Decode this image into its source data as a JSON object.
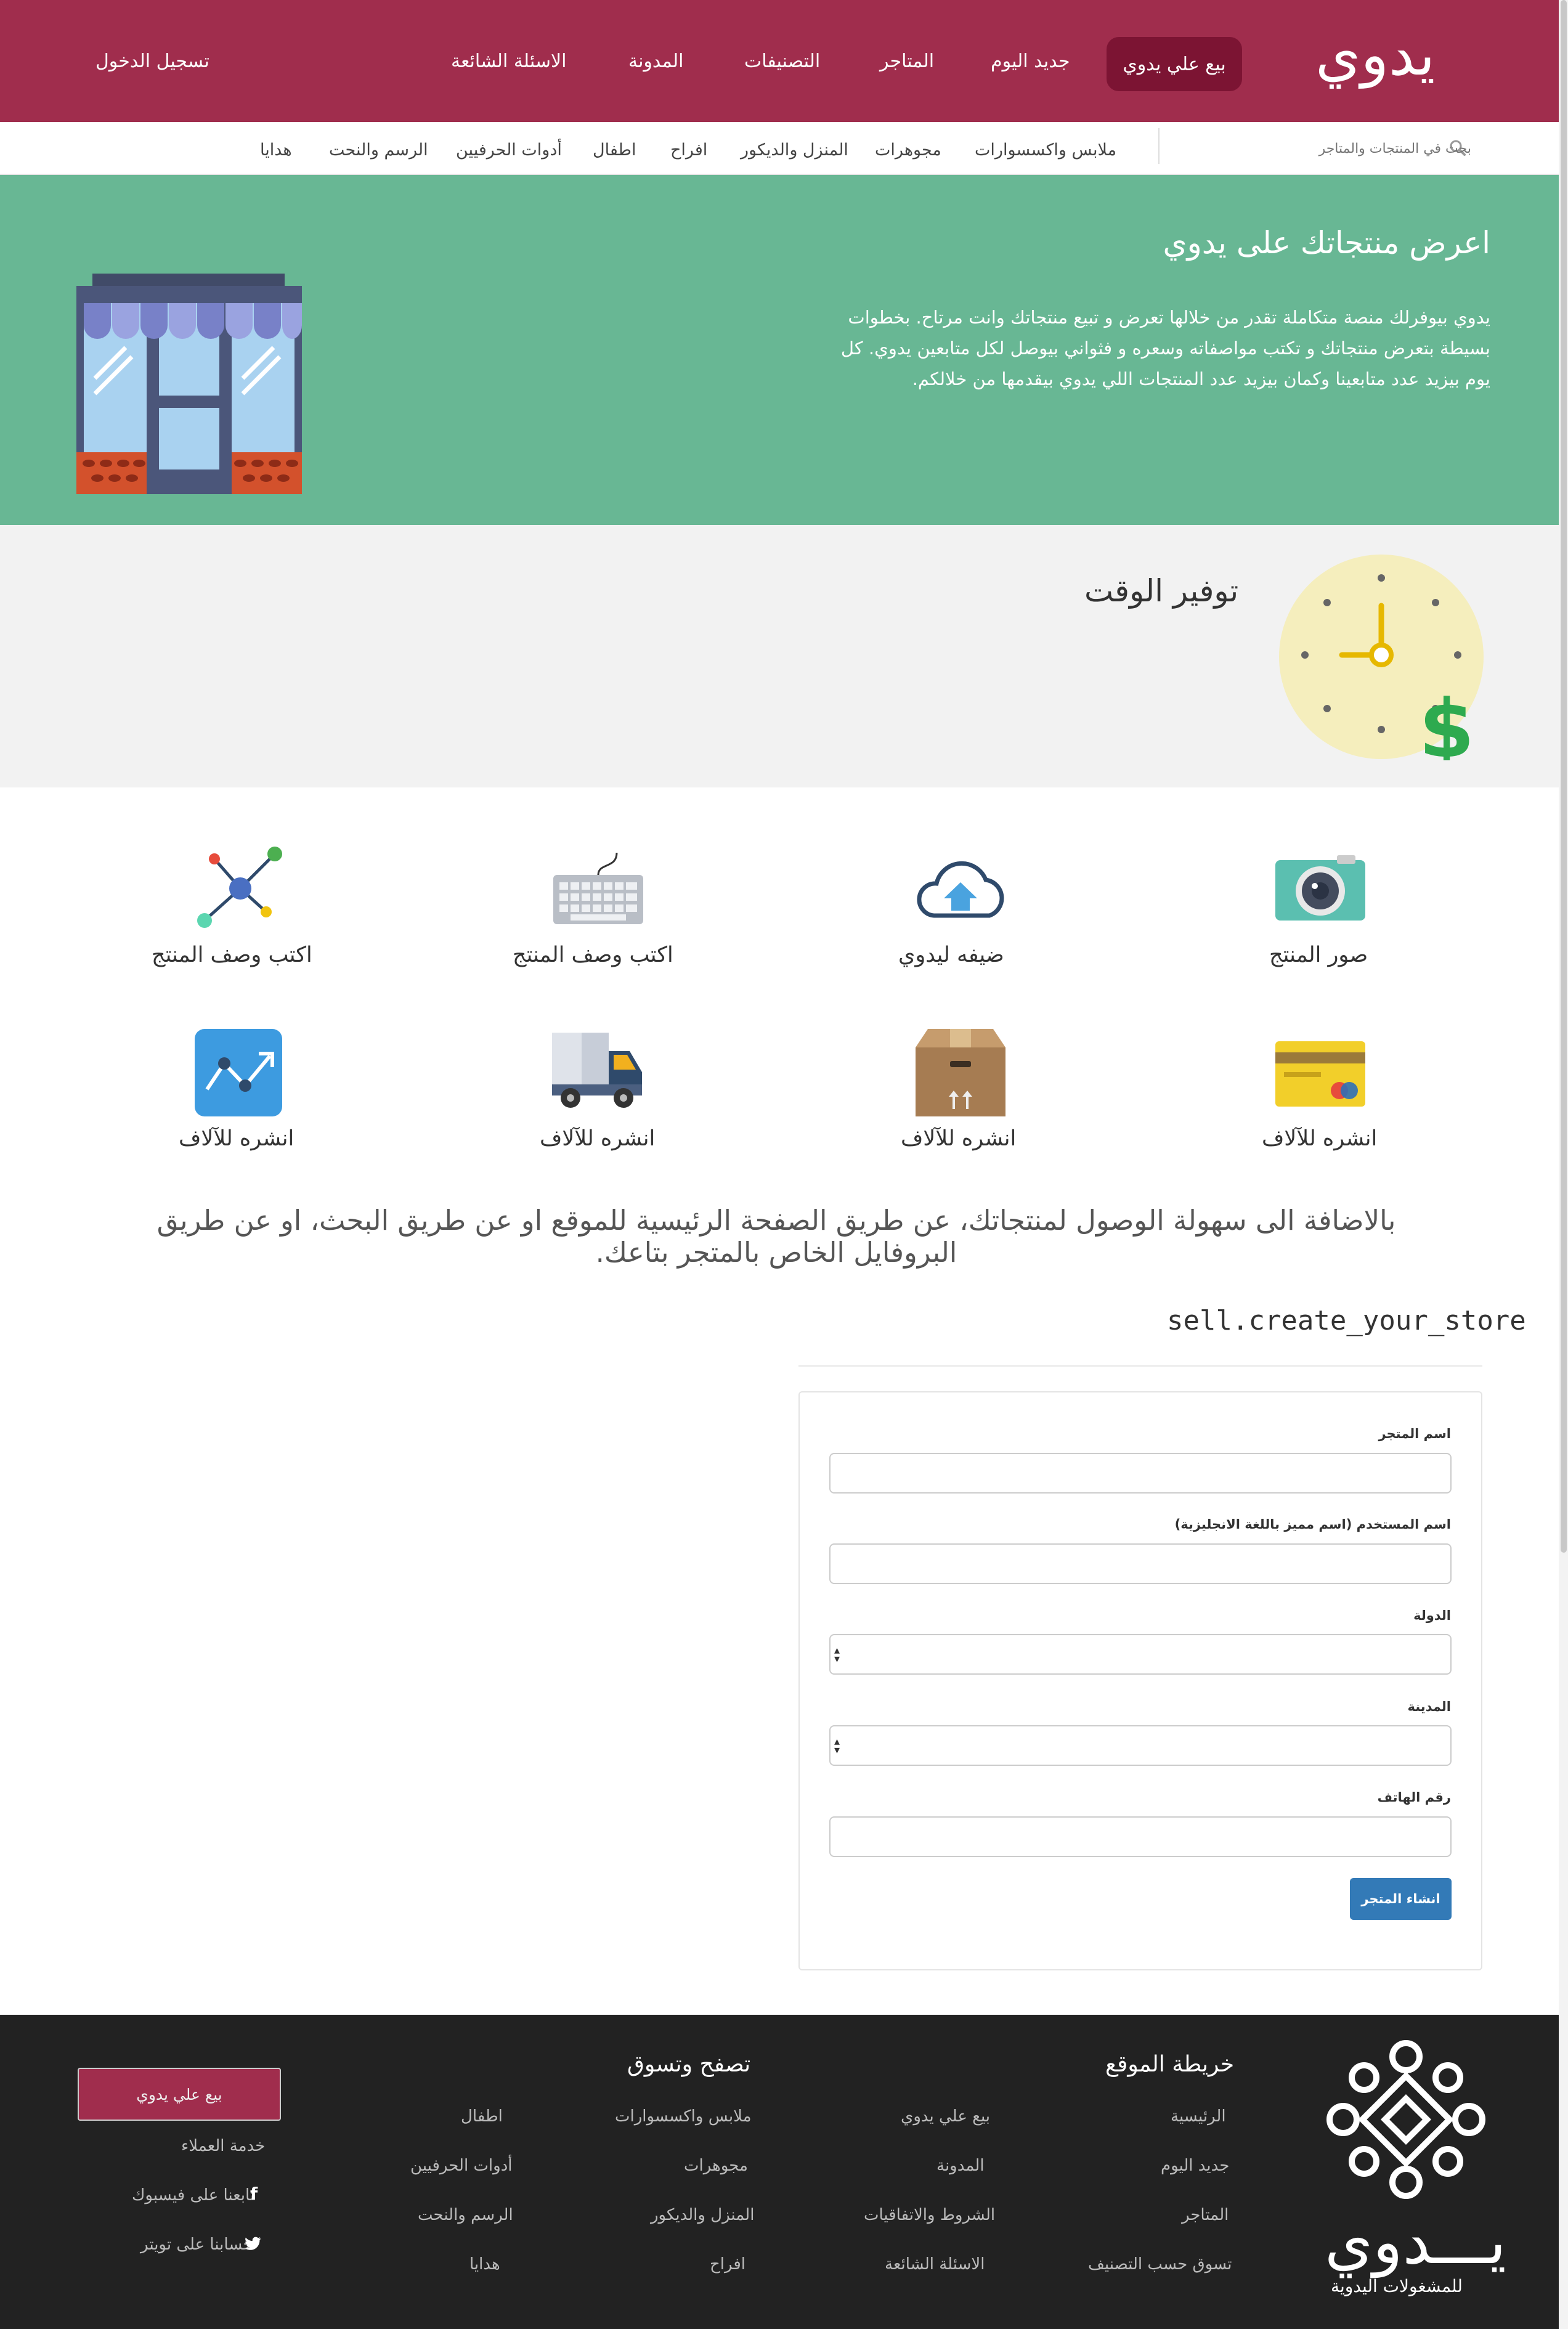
{
  "header": {
    "logo_text": "يدوي",
    "sell_button": "بيع علي يدوي",
    "nav": [
      "جديد اليوم",
      "المتاجر",
      "التصنيفات",
      "المدونة",
      "الاسئلة الشائعة"
    ],
    "login": "تسجيل الدخول",
    "bg_color": "#a02d4d"
  },
  "subnav": {
    "search_placeholder": "بحث في المنتجات والمتاجر",
    "categories": [
      "ملابس واكسسوارات",
      "مجوهرات",
      "المنزل والديكور",
      "افراح",
      "اطفال",
      "أدوات الحرفيين",
      "الرسم والنحت",
      "هدايا"
    ]
  },
  "hero": {
    "title": "اعرض منتجاتك على يدوي",
    "description": "يدوي بيوفرلك منصة متكاملة تقدر من خلالها تعرض و تبيع منتجاتك وانت مرتاح. بخطوات بسيطة بتعرض منتجاتك و تكتب مواصفاته وسعره و فثواني بيوصل لكل متابعين يدوي. كل يوم بيزيد عدد متابعينا وكمان بيزيد عدد المنتجات اللي يدوي بيقدمها من خلالكم.",
    "bg_color": "#68b794"
  },
  "time_section": {
    "title": "توفير الوقت"
  },
  "features": [
    {
      "label": "صور المنتج",
      "icon": "camera-icon"
    },
    {
      "label": "ضيفه ليدوي",
      "icon": "cloud-upload-icon"
    },
    {
      "label": "اكتب وصف المنتج",
      "icon": "keyboard-icon"
    },
    {
      "label": "اكتب وصف المنتج",
      "icon": "network-icon"
    },
    {
      "label": "انشره للآلاف",
      "icon": "credit-card-icon"
    },
    {
      "label": "انشره للآلاف",
      "icon": "box-icon"
    },
    {
      "label": "انشره للآلاف",
      "icon": "truck-icon"
    },
    {
      "label": "انشره للآلاف",
      "icon": "chart-icon"
    }
  ],
  "tagline": "بالاضافة الى سهولة الوصول لمنتجاتك، عن طريق الصفحة الرئيسية للموقع او عن طريق البحث، او عن طريق البروفايل الخاص بالمتجر بتاعك.",
  "store_form": {
    "title": "sell.create_your_store",
    "fields": [
      {
        "label": "اسم المتجر",
        "value": ""
      },
      {
        "label": "اسم المستخدم (اسم مميز باللغة الانجليزية)",
        "value": ""
      },
      {
        "label": "الدولة",
        "value": ""
      },
      {
        "label": "المدينة",
        "value": ""
      },
      {
        "label": "رقم الهاتف",
        "value": ""
      }
    ],
    "submit": "انشاء المتجر",
    "submit_color": "#337ab7"
  },
  "footer": {
    "sitemap_title": "خريطة الموقع",
    "sitemap_col1": [
      "الرئيسية",
      "جديد اليوم",
      "المتاجر",
      "تسوق حسب التصنيف"
    ],
    "sitemap_col2": [
      "بيع علي يدوي",
      "المدونة",
      "الشروط والاتفاقيات",
      "الاسئلة الشائعة"
    ],
    "browse_title": "تصفح وتسوق",
    "browse_col1": [
      "ملابس واكسسوارات",
      "مجوهرات",
      "المنزل والديكور",
      "افراح"
    ],
    "browse_col2": [
      "اطفال",
      "أدوات الحرفيين",
      "الرسم والنحت",
      "هدايا"
    ],
    "sell_button": "بيع علي يدوي",
    "customer_service": "خدمة العملاء",
    "facebook": "تابعنا على فيسبوك",
    "twitter": "حسابنا على تويتر",
    "logo_text": "يـــدوي",
    "logo_sub": "للمشغولات اليدوية",
    "bg_color": "#222222"
  }
}
